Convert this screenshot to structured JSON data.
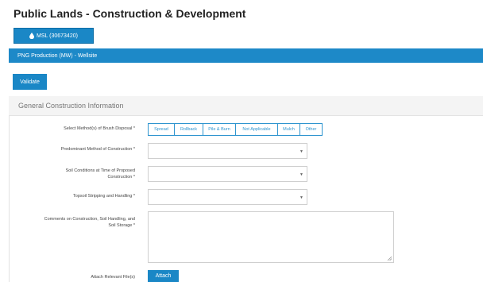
{
  "page": {
    "title": "Public Lands - Construction & Development"
  },
  "msl_button": {
    "label": "MSL (30673420)",
    "icon": "drop-icon"
  },
  "blue_bar": {
    "text": "PNG Production (MW) - Wellsite"
  },
  "validate_button": {
    "label": "Validate"
  },
  "section": {
    "title": "General Construction Information"
  },
  "fields": {
    "brush_disposal": {
      "label": "Select Method(s) of Brush Disposal *",
      "options": [
        "Spread",
        "Rollback",
        "Pile & Burn",
        "Not Applicable",
        "Mulch",
        "Other"
      ]
    },
    "predominant_method": {
      "label": "Predominant Method of Construction *",
      "value": ""
    },
    "soil_conditions": {
      "label_line1": "Soil Conditions at Time of Proposed",
      "label_line2": "Construction *",
      "value": ""
    },
    "topsoil": {
      "label": "Topsoil Stripping and Handling *",
      "value": ""
    },
    "comments": {
      "label_line1": "Comments on Construction, Soil Handling, and",
      "label_line2": "Soil Storage *",
      "value": ""
    },
    "attach": {
      "label": "Attach Relevant File(s)",
      "button": "Attach"
    }
  },
  "colors": {
    "accent": "#1a87c6",
    "bar": "#1d89c8",
    "outline_button": "#2f95cf"
  }
}
